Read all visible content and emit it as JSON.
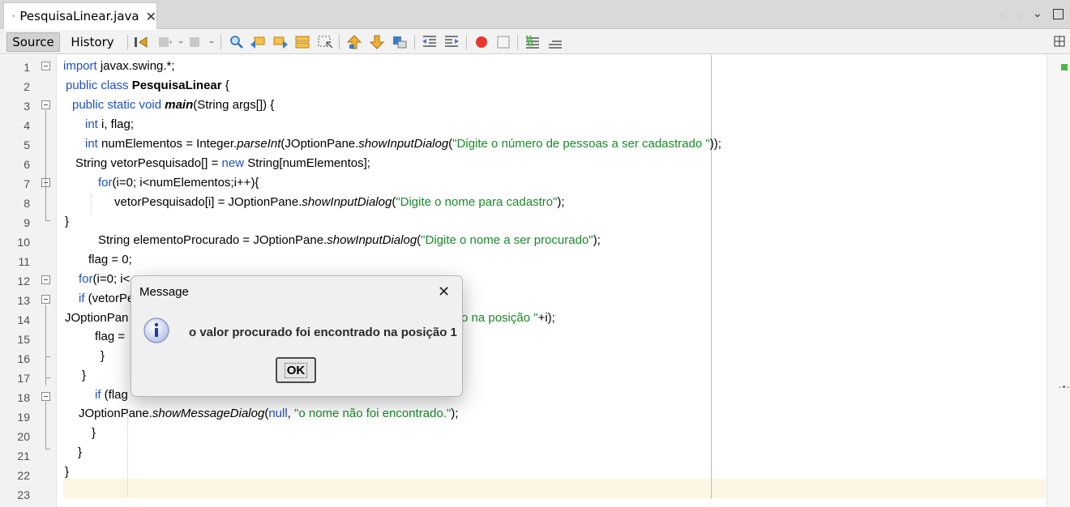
{
  "tab": {
    "label": "PesquisaLinear.java",
    "close": "✕"
  },
  "toolbar": {
    "source_label": "Source",
    "history_label": "History"
  },
  "line_numbers": [
    "1",
    "2",
    "3",
    "4",
    "5",
    "6",
    "7",
    "8",
    "9",
    "10",
    "11",
    "12",
    "13",
    "14",
    "15",
    "16",
    "17",
    "18",
    "19",
    "20",
    "21",
    "22",
    "23"
  ],
  "code": {
    "l1": {
      "kw": "import",
      "rest": " javax.swing.*;"
    },
    "l2": {
      "kw": "public class ",
      "name": "PesquisaLinear",
      "rest": " {"
    },
    "l3": {
      "kw": "public static void ",
      "name": "main",
      "rest": "(String args[]) {"
    },
    "l4": {
      "kw": "int",
      "rest": " i, flag;"
    },
    "l5": {
      "kw": "int",
      "a": " numElementos = Integer.",
      "m1": "parseInt",
      "b": "(JOptionPane.",
      "m2": "showInputDialog",
      "c": "(",
      "s": "\"Digite o número de pessoas a ser cadastrado \"",
      "d": "));"
    },
    "l6": {
      "a": "String vetorPesquisado[] = ",
      "kw": "new",
      "b": " String[numElementos];"
    },
    "l7": {
      "kw": "for",
      "rest": "(i=0; i<numElementos;i++){"
    },
    "l8": {
      "a": "vetorPesquisado[i] = JOptionPane.",
      "m": "showInputDialog",
      "b": "(",
      "s": "\"Digite o nome para cadastro\"",
      "c": ");"
    },
    "l9": {
      "text": "}"
    },
    "l10": {
      "a": "String elementoProcurado = JOptionPane.",
      "m": "showInputDialog",
      "b": "(",
      "s": "\"Digite o nome a ser procurado\"",
      "c": ");"
    },
    "l11": {
      "text": "flag = 0;"
    },
    "l12": {
      "kw": "for",
      "rest": "(i=0; i<"
    },
    "l13": {
      "kw": "if",
      "rest": " (vetorPe"
    },
    "l14": {
      "a": "JOptionPan",
      "s": "o na posição \"",
      "b": "+i);"
    },
    "l15": {
      "text": "flag ="
    },
    "l16": {
      "text": "}"
    },
    "l17": {
      "text": "}"
    },
    "l18": {
      "kw": "if",
      "rest": " (flag"
    },
    "l19": {
      "a": "JOptionPane.",
      "m": "showMessageDialog",
      "b": "(",
      "kw": "null",
      "c": ", ",
      "s": "\"o nome não foi encontrado.\"",
      "d": ");"
    },
    "l20": {
      "text": "}"
    },
    "l21": {
      "text": "}"
    },
    "l22": {
      "text": "}"
    }
  },
  "dialog": {
    "title": "Message",
    "close": "✕",
    "message": "o valor procurado foi encontrado na posição 1",
    "ok_label": "OK",
    "icon": "information-icon"
  },
  "colors": {
    "keyword": "#2050c8",
    "string": "#1a8a2a",
    "current_line": "#fbf6e4"
  }
}
